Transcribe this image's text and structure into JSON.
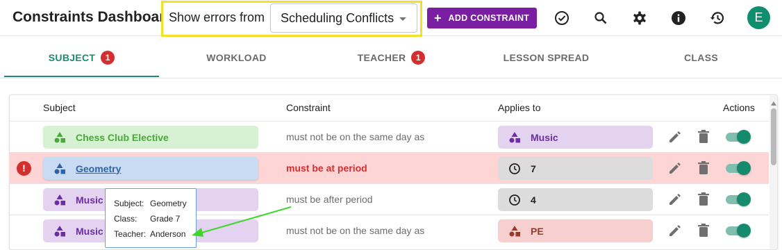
{
  "header": {
    "title": "Constraints Dashboard",
    "filter_label": "Show errors from",
    "filter_value": "Scheduling Conflicts",
    "add_button_label": "ADD CONSTRAINT",
    "avatar_initial": "E",
    "icons": [
      "check-circle-icon",
      "search-icon",
      "gear-icon",
      "info-icon",
      "history-icon"
    ]
  },
  "tabs": [
    {
      "label": "SUBJECT",
      "badge": "1",
      "active": true
    },
    {
      "label": "WORKLOAD",
      "badge": null,
      "active": false
    },
    {
      "label": "TEACHER",
      "badge": "1",
      "active": false
    },
    {
      "label": "LESSON SPREAD",
      "badge": null,
      "active": false
    },
    {
      "label": "CLASS",
      "badge": null,
      "active": false
    }
  ],
  "table": {
    "columns": [
      "Subject",
      "Constraint",
      "Applies to",
      "Actions"
    ],
    "rows": [
      {
        "error": false,
        "subject": "Chess Club Elective",
        "subject_color": "green",
        "constraint": "must not be on the same day as",
        "applies_icon": "shapes-icon",
        "applies": "Music",
        "applies_color": "purple",
        "enabled": true
      },
      {
        "error": true,
        "subject": "Geometry",
        "subject_color": "blue",
        "constraint": "must be at period",
        "applies_icon": "clock-icon",
        "applies": "7",
        "applies_color": "grey",
        "enabled": true
      },
      {
        "error": false,
        "subject": "Music",
        "subject_color": "purple",
        "constraint": "must be after period",
        "applies_icon": "clock-icon",
        "applies": "4",
        "applies_color": "grey",
        "enabled": true
      },
      {
        "error": false,
        "subject": "Music",
        "subject_color": "purple",
        "constraint": "must not be on the same day as",
        "applies_icon": "shapes-icon",
        "applies": "PE",
        "applies_color": "red",
        "enabled": true
      }
    ]
  },
  "tooltip": {
    "subject_key": "Subject:",
    "subject_val": "Geometry",
    "class_key": "Class:",
    "class_val": "Grade 7",
    "teacher_key": "Teacher:",
    "teacher_val": "Anderson"
  },
  "colors": {
    "accent": "#1a8a74",
    "brand_button": "#7b1fa2",
    "error": "#d32f2f",
    "error_row_bg": "#fdd5d5",
    "highlight_box": "#f2e12a",
    "annotation_arrow": "#3fd62a"
  }
}
